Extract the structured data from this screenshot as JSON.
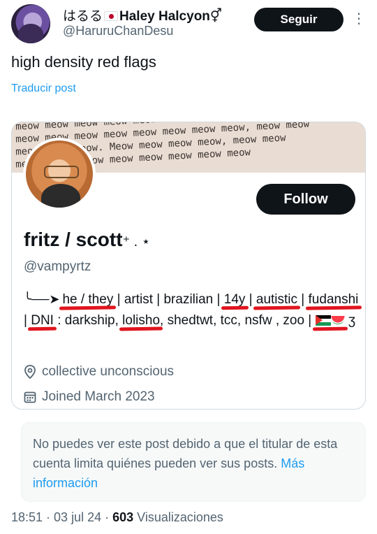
{
  "tweet": {
    "author_name_prefix": "はるる",
    "author_name": "Haley Halcyon",
    "author_name_suffix": "⚥",
    "handle": "@HaruruChanDesu",
    "follow_label": "Seguir",
    "more_icon": "more-dots-icon",
    "text": "high density red flags",
    "translate_label": "Traducir post"
  },
  "embedded_profile": {
    "banner_lines": [
      "ow meow meow meow meow meow meow meow meow.",
      "ow meow meow meow meow meow meow meow meow, meow meow",
      "ow meow meow meow. Meow meow meow meow, meow meow",
      "ow meow. Meow meow meow meow meow meow meow"
    ],
    "follow_label": "Follow",
    "name": "fritz / scott",
    "name_suffix": "⁺ . ⋆",
    "handle": "@vampyrtz",
    "bio": {
      "arrow": "╰──➤",
      "pronouns": "he / they",
      "sep1": " | artist | brazilian | ",
      "age": "14y",
      "sep2": " | ",
      "autistic": "autistic",
      "sep3": " | ",
      "fudanshi": "fudanshi",
      "sep4": " | ",
      "dni": "DNI",
      "sep5": " : darkship, ",
      "lolisho": "lolisho",
      "sep6": ", shedtwt, tcc, nsfw , zoo | ",
      "tail": " ʒ"
    },
    "location": "collective unconscious",
    "joined": "Joined March 2023"
  },
  "notice": {
    "text": "No puedes ver este post debido a que el titular de esta cuenta limita quiénes pueden ver sus posts. ",
    "link": "Más información"
  },
  "footer": {
    "time_date": "18:51 · 03 jul 24 · ",
    "views_count": "603",
    "views_label": " Visualizaciones"
  },
  "colors": {
    "accent": "#1d9bf0",
    "underline_red": "#e0151f",
    "button_dark": "#0f1419",
    "muted": "#536471"
  }
}
